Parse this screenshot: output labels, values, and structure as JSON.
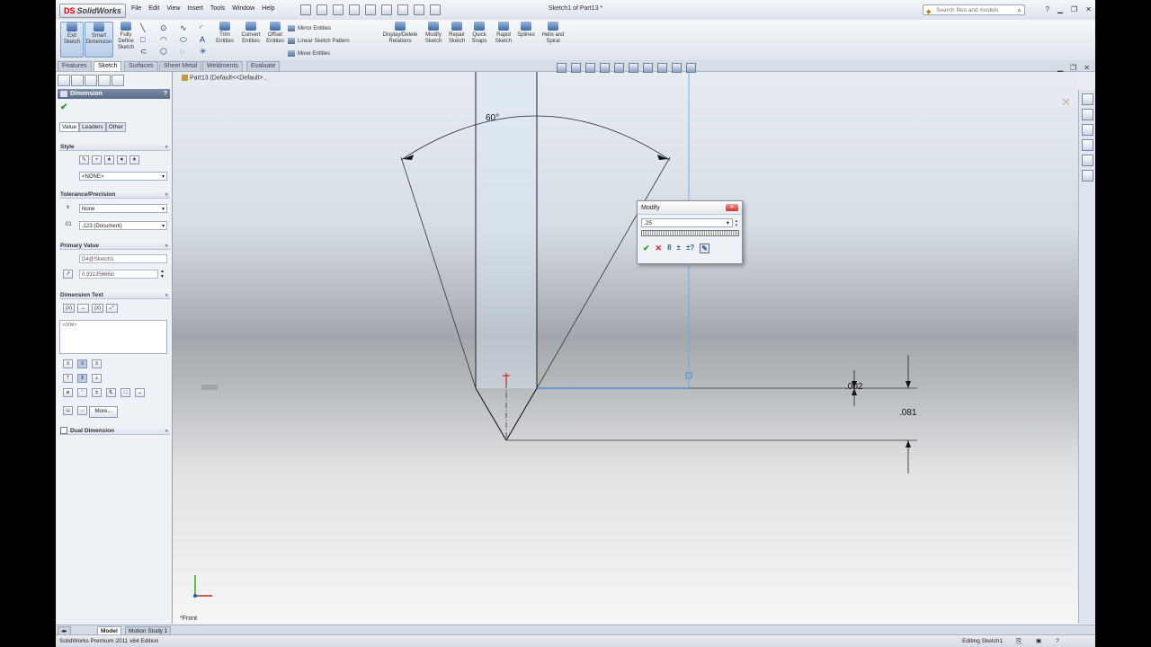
{
  "app": {
    "name": "SolidWorks",
    "window_title": "Sketch1 of Part13 *",
    "menu": [
      "File",
      "Edit",
      "View",
      "Insert",
      "Tools",
      "Window",
      "Help"
    ],
    "search_placeholder": "Search files and models"
  },
  "ribbon": {
    "exit_sketch": "Exit Sketch",
    "smart_dimension": "Smart Dimension",
    "fully_define": "Fully Define Sketch",
    "trim": "Trim Entities",
    "convert": "Convert Entities",
    "offset": "Offset Entities",
    "mirror": "Mirror Entities",
    "linear_pattern": "Linear Sketch Pattern",
    "move": "Move Entities",
    "display_delete": "Display/Delete Relations",
    "modify_sketch": "Modify Sketch",
    "repair_sketch": "Repair Sketch",
    "quick_snaps": "Quick Snaps",
    "rapid_sketch": "Rapid Sketch",
    "splines": "Splines",
    "helix": "Helix and Spiral"
  },
  "tabs": [
    "Features",
    "Sketch",
    "Surfaces",
    "Sheet Metal",
    "Weldments",
    "Evaluate"
  ],
  "active_tab": "Sketch",
  "property_manager": {
    "title": "Dimension",
    "help": "?",
    "value_tabs": [
      "Value",
      "Leaders",
      "Other"
    ],
    "sections": {
      "style": "Style",
      "style_select": "<NONE>",
      "tolerance": "Tolerance/Precision",
      "tolerance_type": "None",
      "precision": ".123 (Document)",
      "primary_value": "Primary Value",
      "dimension_name": "D4@Sketch1",
      "dimension_value": "0.93135666in",
      "dimension_text": "Dimension Text",
      "dim_text_content": "<DIM>",
      "more_button": "More...",
      "dual_dimension": "Dual Dimension"
    }
  },
  "viewport": {
    "tree_item": "Part13  (Default<<Default>...",
    "angle_dim": "60°",
    "dim_small": ".002",
    "dim_height": ".081",
    "view_label": "*Front"
  },
  "modify_dialog": {
    "title": "Modify",
    "value": ".25"
  },
  "bottom_tabs": [
    "Model",
    "Motion Study 1"
  ],
  "status": {
    "left": "SolidWorks Premium 2011 x64 Edition",
    "right": "Editing Sketch1"
  }
}
